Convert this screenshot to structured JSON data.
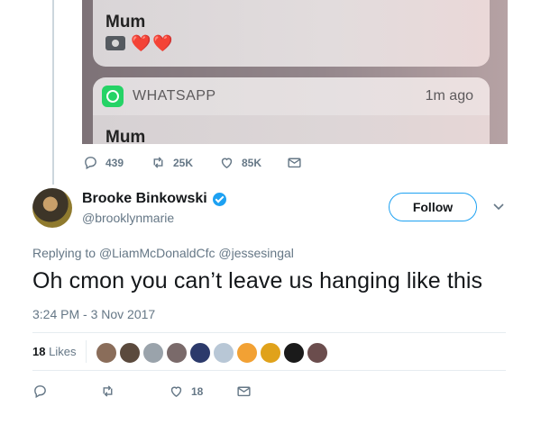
{
  "quoted_screenshot": {
    "top_notification": {
      "sender": "Mum",
      "emoji": "❤️❤️"
    },
    "bottom_notification": {
      "app": "WHATSAPP",
      "time": "1m ago",
      "sender": "Mum"
    }
  },
  "quoted_actions": {
    "replies": "439",
    "retweets": "25K",
    "likes": "85K"
  },
  "tweet": {
    "author_name": "Brooke Binkowski",
    "author_handle": "@brooklynmarie",
    "follow_label": "Follow",
    "replying_prefix": "Replying to",
    "replying_to": "@LiamMcDonaldCfc @jessesingal",
    "text": "Oh cmon you can’t leave us hanging like this",
    "timestamp": "3:24 PM - 3 Nov 2017",
    "likes_count": "18",
    "likes_label": "Likes"
  },
  "tweet_actions": {
    "likes": "18"
  },
  "colors": {
    "accent": "#1da1f2",
    "secondary_text": "#657786",
    "primary_text": "#14171a",
    "whatsapp": "#25d366"
  },
  "liker_avatars": [
    "#8a6d5a",
    "#5b4a3d",
    "#9aa3ab",
    "#7a6a6a",
    "#2c3a6b",
    "#b8c7d6",
    "#f2a134",
    "#e0a21b",
    "#1a1a1a",
    "#6b4d4d"
  ]
}
